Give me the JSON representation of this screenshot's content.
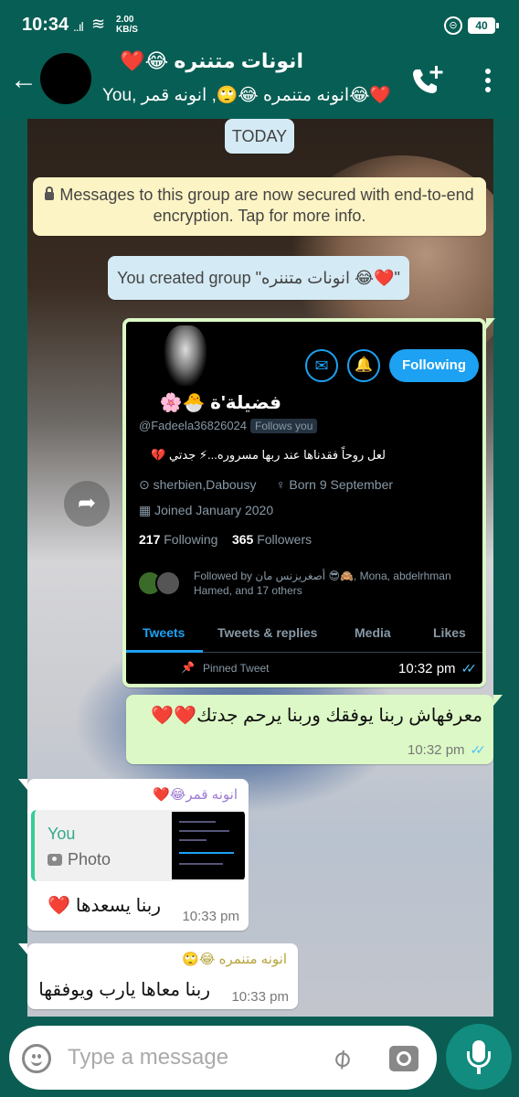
{
  "status_bar": {
    "time": "10:34",
    "signal": "..ıl",
    "wifi": "≋",
    "net_speed_value": "2.00",
    "net_speed_unit": "KB/S",
    "battery": "40"
  },
  "header": {
    "title": "انونات متننره 😂❤️",
    "subtitle": "You, انونه متنمره 😂🙄, انونه قمر😂❤️"
  },
  "chat": {
    "date_label": "TODAY",
    "encryption_notice": "Messages to this group are now secured with end-to-end encryption. Tap for more info.",
    "system_created": "You created group \"انونات متننره 😂❤️\""
  },
  "image_message": {
    "time": "10:32 pm",
    "ticks": "✓✓",
    "tweet_profile": {
      "follow_button": "Following",
      "display_name": "فضيلة'ة 🐣🌸",
      "handle": "@Fadeela36826024",
      "follows_you": "Follows you",
      "bio": "لعل روحاً فقدناها عند ربها مسروره...⚡ جدتي 💔",
      "location": "sherbien,Dabousy",
      "born": "Born 9 September",
      "joined": "Joined January 2020",
      "following_count": "217",
      "following_label": "Following",
      "followers_count": "365",
      "followers_label": "Followers",
      "followed_by": "Followed by أصغريزنس مان 😎🙈, Mona, abdelrhman Hamed, and 17 others",
      "tabs": [
        "Tweets",
        "Tweets & replies",
        "Media",
        "Likes"
      ],
      "pinned": "Pinned Tweet"
    }
  },
  "messages": [
    {
      "direction": "out",
      "text": "معرفهاش ربنا يوفقك وربنا يرحم جدتك❤️❤️",
      "time": "10:32 pm",
      "ticks": "✓✓"
    },
    {
      "direction": "in",
      "sender": "انونه قمر😂❤️",
      "quote_name": "You",
      "quote_type": "Photo",
      "text": "ربنا يسعدها ❤️",
      "time": "10:33 pm"
    },
    {
      "direction": "in",
      "sender": "انونه متنمره 😂🙄",
      "text": "ربنا معاها يارب ويوفقها",
      "time": "10:33 pm"
    }
  ],
  "input": {
    "placeholder": "Type a message"
  },
  "colors": {
    "header": "#075e54",
    "outgoing_bubble": "#dcf8c6",
    "incoming_bubble": "#ffffff",
    "accent": "#128c7e",
    "twitter_blue": "#1da1f2"
  },
  "icons": [
    "back-arrow-icon",
    "call-add-icon",
    "more-vert-icon",
    "forward-icon",
    "emoji-icon",
    "attach-icon",
    "camera-icon",
    "mic-icon",
    "lock-icon"
  ]
}
